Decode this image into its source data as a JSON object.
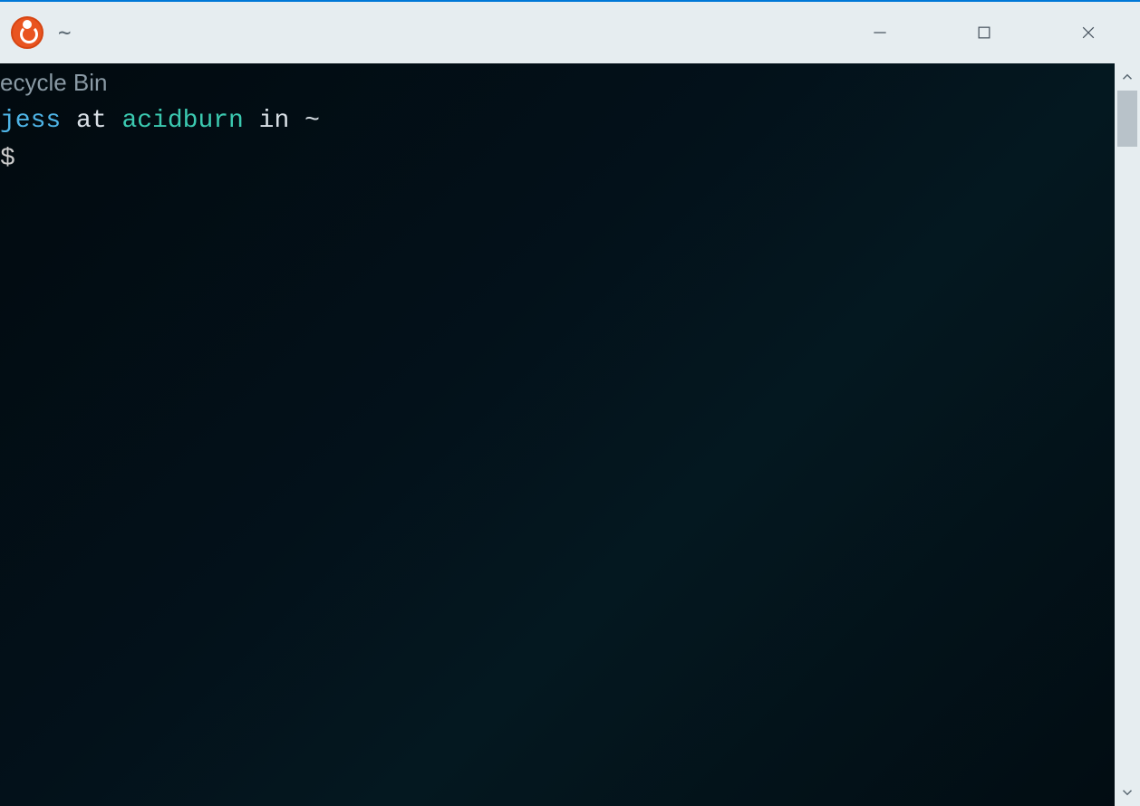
{
  "titlebar": {
    "icon_name": "ubuntu-icon",
    "title": "~"
  },
  "window_controls": {
    "minimize": "Minimize",
    "maximize": "Maximize",
    "close": "Close"
  },
  "desktop": {
    "background_label": "ecycle Bin"
  },
  "terminal": {
    "prompt": {
      "user": "jess",
      "at": " at ",
      "host": "acidburn",
      "in": " in ",
      "path": "~",
      "symbol": "$"
    }
  },
  "colors": {
    "titlebar_bg": "#e6edf0",
    "terminal_bg": "#03111a",
    "user_color": "#4eb4e6",
    "host_color": "#3bc9b0",
    "text_color": "#d9e0e6",
    "accent": "#e95420"
  }
}
